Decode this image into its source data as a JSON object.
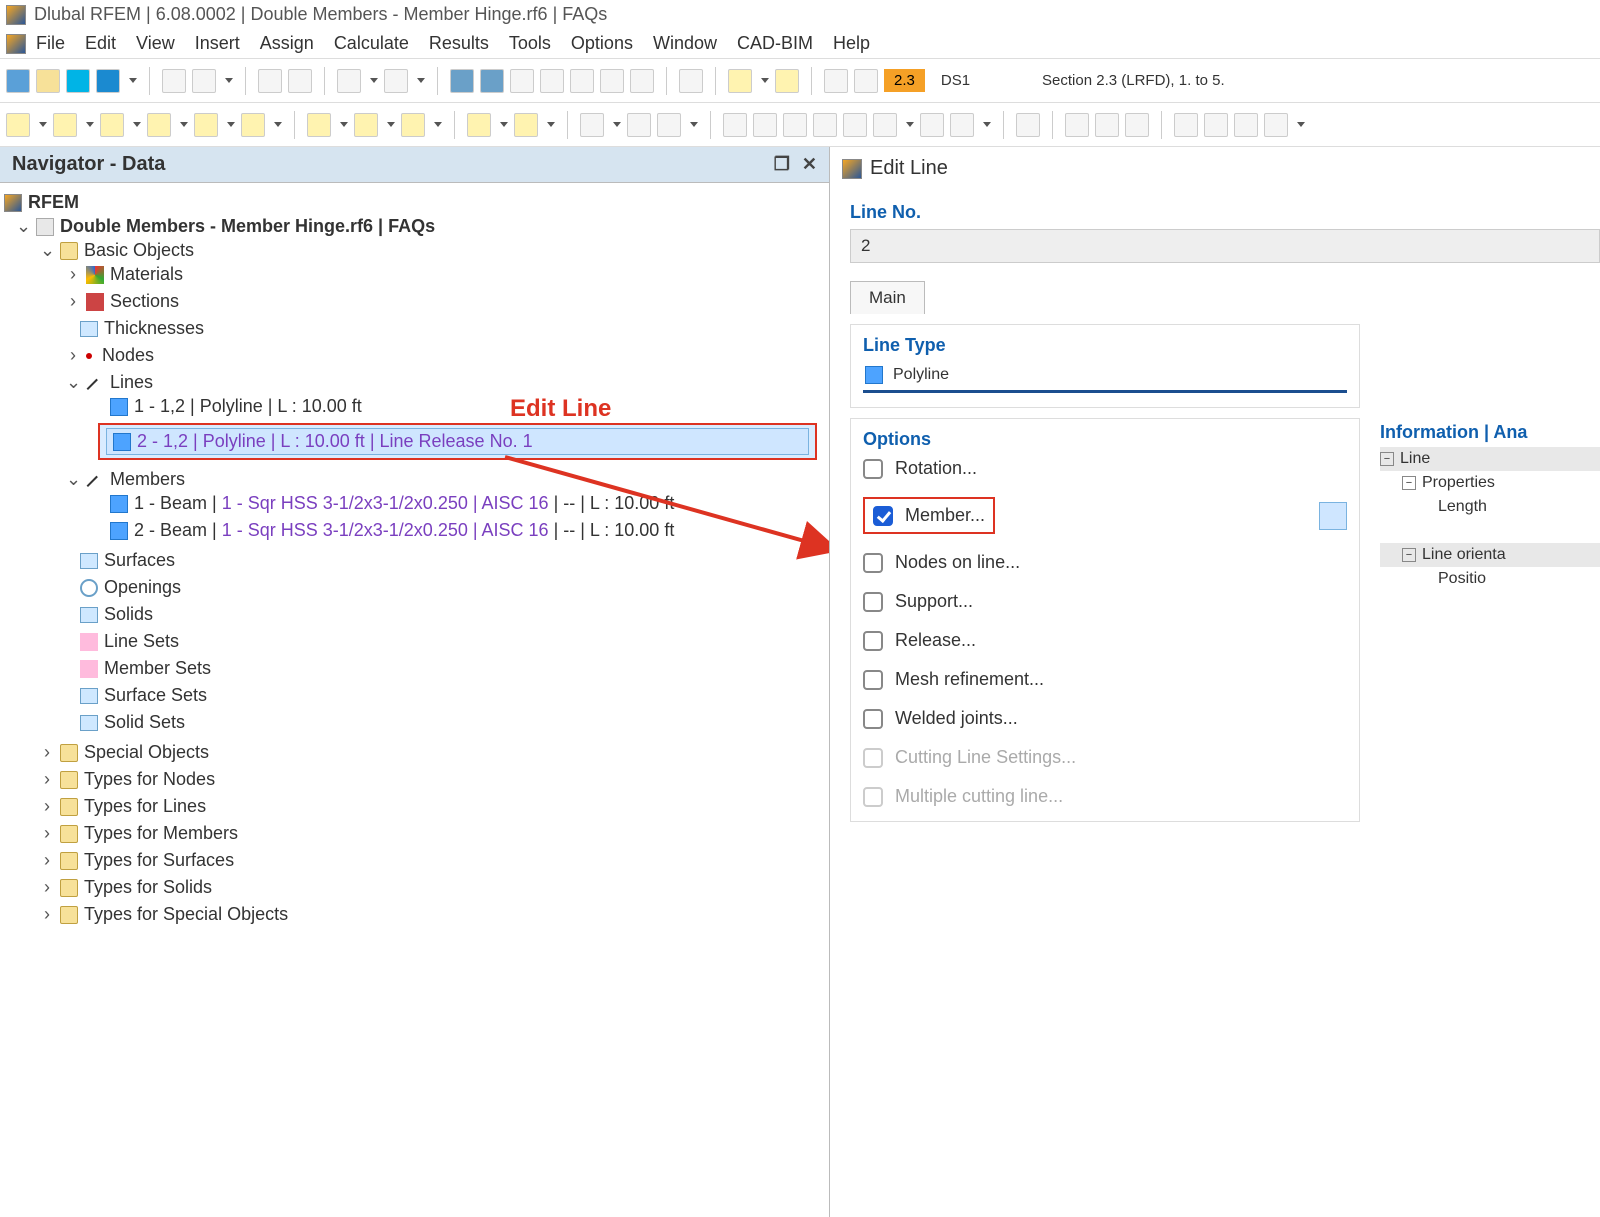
{
  "title": "Dlubal RFEM | 6.08.0002 | Double Members - Member Hinge.rf6 | FAQs",
  "menu": [
    "File",
    "Edit",
    "View",
    "Insert",
    "Assign",
    "Calculate",
    "Results",
    "Tools",
    "Options",
    "Window",
    "CAD-BIM",
    "Help"
  ],
  "toolbar": {
    "orange_label": "2.3",
    "ds_label": "DS1",
    "section_label": "Section 2.3 (LRFD), 1. to 5."
  },
  "navigator": {
    "header": "Navigator - Data",
    "root": "RFEM",
    "project": "Double Members - Member Hinge.rf6 | FAQs",
    "basic_objects": "Basic Objects",
    "materials": "Materials",
    "sections": "Sections",
    "thicknesses": "Thicknesses",
    "nodes": "Nodes",
    "lines": "Lines",
    "line1": "1 - 1,2 | Polyline | L : 10.00 ft",
    "line2": "2 - 1,2 | Polyline | L : 10.00 ft | Line Release No. 1",
    "members": "Members",
    "member1_pre": "1 - Beam | ",
    "member1_link": "1 - Sqr HSS 3-1/2x3-1/2x0.250 | AISC 16",
    "member1_post": " | -- | L : 10.00 ft",
    "member2_pre": "2 - Beam | ",
    "member2_link": "1 - Sqr HSS 3-1/2x3-1/2x0.250 | AISC 16",
    "member2_post": " | -- | L : 10.00 ft",
    "surfaces": "Surfaces",
    "openings": "Openings",
    "solids": "Solids",
    "line_sets": "Line Sets",
    "member_sets": "Member Sets",
    "surface_sets": "Surface Sets",
    "solid_sets": "Solid Sets",
    "special_objects": "Special Objects",
    "types_nodes": "Types for Nodes",
    "types_lines": "Types for Lines",
    "types_members": "Types for Members",
    "types_surfaces": "Types for Surfaces",
    "types_solids": "Types for Solids",
    "types_special": "Types for Special Objects"
  },
  "callout": "Edit Line",
  "panel": {
    "title": "Edit Line",
    "line_no_label": "Line No.",
    "line_no_value": "2",
    "tab_main": "Main",
    "line_type_label": "Line Type",
    "line_type_value": "Polyline",
    "options_label": "Options",
    "opt_rotation": "Rotation...",
    "opt_member": "Member...",
    "opt_nodes_on_line": "Nodes on line...",
    "opt_support": "Support...",
    "opt_release": "Release...",
    "opt_mesh": "Mesh refinement...",
    "opt_welded": "Welded joints...",
    "opt_cutting_settings": "Cutting Line Settings...",
    "opt_multiple_cutting": "Multiple cutting line..."
  },
  "info": {
    "header": "Information | Ana",
    "line": "Line",
    "properties": "Properties",
    "length": "Length",
    "orientation": "Line orienta",
    "position": "Positio"
  }
}
